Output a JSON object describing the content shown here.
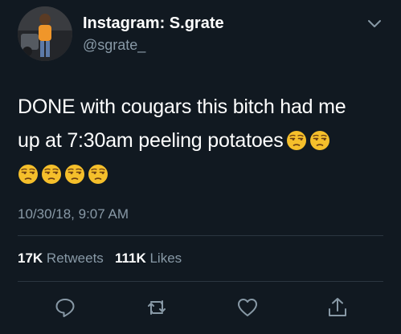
{
  "author": {
    "name": "Instagram: S.grate",
    "handle": "@sgrate_"
  },
  "tweet": {
    "line1": "DONE with cougars  this bitch had me",
    "line2": "up at 7:30am peeling potatoes",
    "emoji": "unamused-face-emoji",
    "emoji_count": 6
  },
  "timestamp": "10/30/18, 9:07 AM",
  "stats": {
    "retweets_count": "17K",
    "retweets_label": "Retweets",
    "likes_count": "111K",
    "likes_label": "Likes"
  },
  "actions": [
    {
      "icon": "reply-icon"
    },
    {
      "icon": "retweet-icon"
    },
    {
      "icon": "like-icon"
    },
    {
      "icon": "share-icon"
    }
  ],
  "colors": {
    "background": "#111921",
    "text": "#ffffff",
    "secondary": "#8899a6",
    "divider": "#2b3640",
    "emoji": "#f5bf2b"
  }
}
